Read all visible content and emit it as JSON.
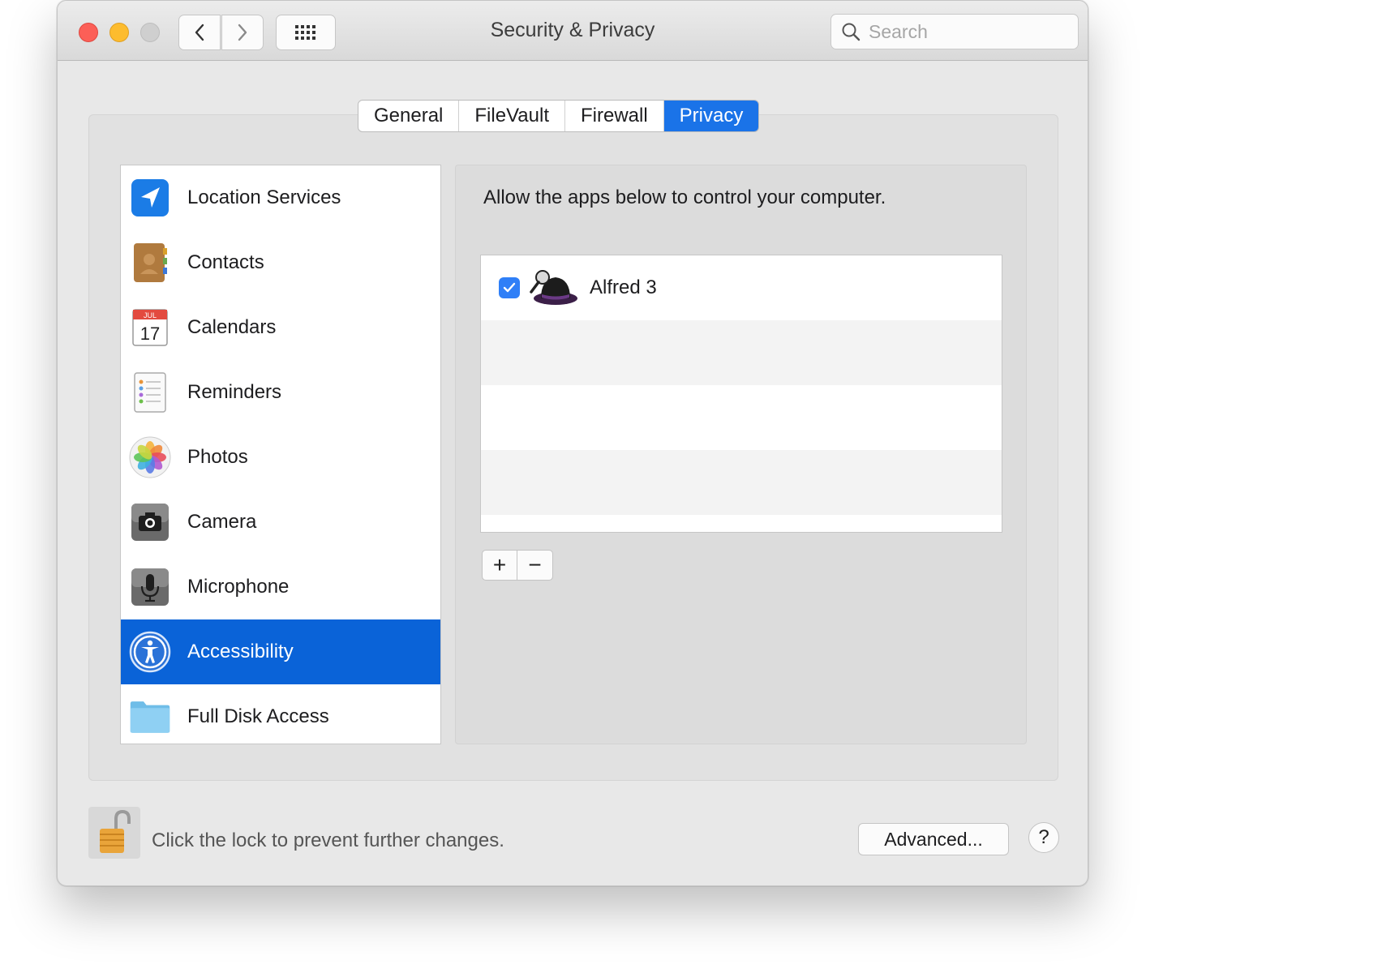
{
  "window": {
    "title": "Security & Privacy"
  },
  "search": {
    "placeholder": "Search"
  },
  "tabs": [
    {
      "label": "General"
    },
    {
      "label": "FileVault"
    },
    {
      "label": "Firewall"
    },
    {
      "label": "Privacy",
      "active": true
    }
  ],
  "sidebar": {
    "items": [
      {
        "label": "Location Services",
        "icon": "location-arrow-icon"
      },
      {
        "label": "Contacts",
        "icon": "contacts-book-icon"
      },
      {
        "label": "Calendars",
        "icon": "calendar-icon",
        "calendar_month": "JUL",
        "calendar_day": "17"
      },
      {
        "label": "Reminders",
        "icon": "reminders-list-icon"
      },
      {
        "label": "Photos",
        "icon": "photos-flower-icon"
      },
      {
        "label": "Camera",
        "icon": "camera-icon"
      },
      {
        "label": "Microphone",
        "icon": "microphone-icon"
      },
      {
        "label": "Accessibility",
        "icon": "accessibility-icon",
        "selected": true
      },
      {
        "label": "Full Disk Access",
        "icon": "folder-icon"
      }
    ]
  },
  "main": {
    "description": "Allow the apps below to control your computer.",
    "apps": [
      {
        "name": "Alfred 3",
        "checked": true,
        "icon": "alfred-hat-icon"
      }
    ],
    "add_label": "+",
    "remove_label": "−"
  },
  "footer": {
    "lock_text": "Click the lock to prevent further changes.",
    "advanced_label": "Advanced...",
    "help_label": "?"
  },
  "colors": {
    "accent": "#1a73e8",
    "selection": "#0a63d8",
    "close": "#fc5f57",
    "minimize": "#fdbc2e",
    "zoom_disabled": "#cfcfcf"
  }
}
